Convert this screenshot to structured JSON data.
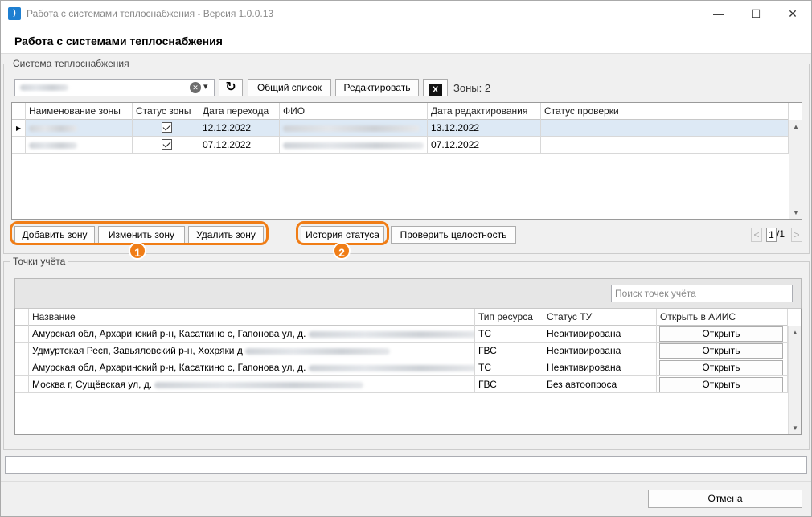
{
  "window": {
    "title": "Работа с системами теплоснабжения - Версия 1.0.0.13",
    "app_icon": ")",
    "minimize": "—",
    "maximize": "☐",
    "close": "✕"
  },
  "header": {
    "title": "Работа с системами теплоснабжения"
  },
  "heat_system": {
    "legend": "Система теплоснабжения",
    "refresh_icon": "↻",
    "clear_icon": "✕",
    "dropdown_icon": "▾",
    "general_list_label": "Общий список",
    "edit_label": "Редактировать",
    "excel_label": "X",
    "zones_count": "Зоны: 2",
    "columns": [
      "Наименование зоны",
      "Статус зоны",
      "Дата перехода",
      "ФИО",
      "Дата редактирования",
      "Статус проверки"
    ],
    "rows": [
      {
        "transition_date": "12.12.2022",
        "edit_date": "13.12.2022",
        "status_checked": true,
        "selected": true
      },
      {
        "transition_date": "07.12.2022",
        "edit_date": "07.12.2022",
        "status_checked": true,
        "selected": false
      }
    ],
    "row_indicator": "▶",
    "buttons": {
      "add_zone": "Добавить зону",
      "edit_zone": "Изменить зону",
      "delete_zone": "Удалить зону",
      "status_history": "История статуса",
      "check_integrity": "Проверить целостность"
    },
    "pager": {
      "prev": "<",
      "page": "1",
      "total": "/1",
      "next": ">"
    },
    "badge_1": "1",
    "badge_2": "2"
  },
  "metering": {
    "legend": "Точки учёта",
    "search_placeholder": "Поиск точек учёта",
    "columns": [
      "Название",
      "Тип ресурса",
      "Статус ТУ",
      "Открыть в АИИС"
    ],
    "rows": [
      {
        "name": "Амурская обл, Архаринский р-н, Касаткино с, Гапонова ул, д.",
        "resource": "ТС",
        "status": "Неактивирована",
        "open": "Открыть"
      },
      {
        "name": "Удмуртская Респ, Завьяловский р-н, Хохряки д",
        "resource": "ГВС",
        "status": "Неактивирована",
        "open": "Открыть"
      },
      {
        "name": "Амурская обл, Архаринский р-н, Касаткино с, Гапонова ул, д.",
        "resource": "ТС",
        "status": "Неактивирована",
        "open": "Открыть"
      },
      {
        "name": "Москва г, Сущёвская ул, д.",
        "resource": "ГВС",
        "status": "Без автоопроса",
        "open": "Открыть"
      }
    ]
  },
  "footer": {
    "cancel_label": "Отмена"
  },
  "colors": {
    "accent": "#f07d16",
    "selection": "#dde9f5"
  }
}
